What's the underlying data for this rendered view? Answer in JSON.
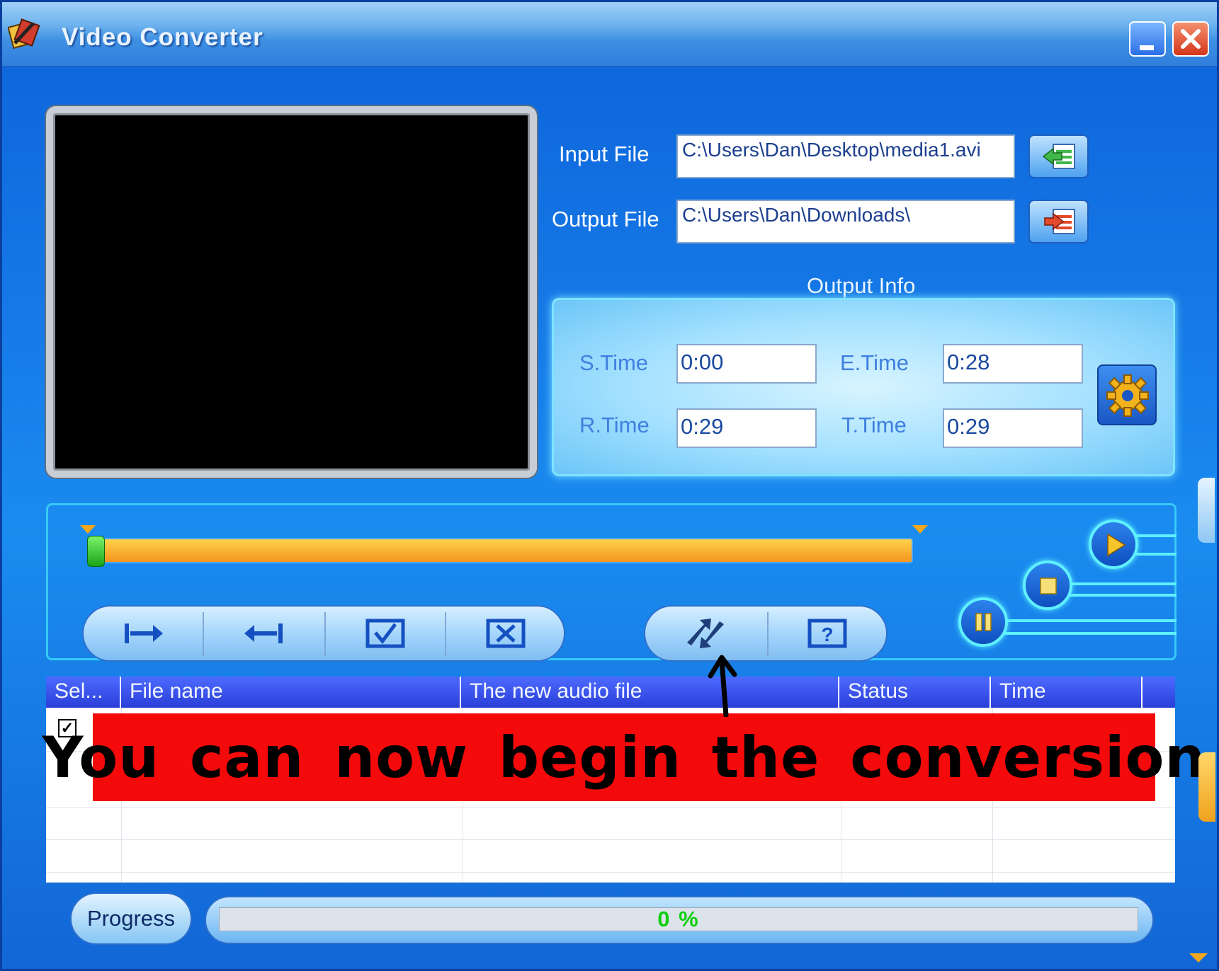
{
  "window": {
    "title": "Video Converter",
    "icons": {
      "app": "app-icon",
      "minimize": "minimize-icon",
      "close": "close-icon"
    }
  },
  "files": {
    "input_label": "Input File",
    "input_value": "C:\\Users\\Dan\\Desktop\\media1.avi",
    "output_label": "Output File",
    "output_value": "C:\\Users\\Dan\\Downloads\\"
  },
  "output_info": {
    "title": "Output Info",
    "s_time_label": "S.Time",
    "s_time_value": "0:00",
    "e_time_label": "E.Time",
    "e_time_value": "0:28",
    "r_time_label": "R.Time",
    "r_time_value": "0:29",
    "t_time_label": "T.Time",
    "t_time_value": "0:29"
  },
  "table": {
    "columns": [
      "Sel...",
      "File name",
      "The new audio file",
      "Status",
      "Time"
    ]
  },
  "annotation": {
    "text": "You can now begin  the  conversion"
  },
  "progress": {
    "button_label": "Progress",
    "value_text": "0 %",
    "value": 0
  },
  "colors": {
    "window_blue": "#1577e6",
    "annotation_red": "#f40a0a",
    "progress_green": "#0ecf0e",
    "glow_cyan": "#5ff0ff"
  }
}
